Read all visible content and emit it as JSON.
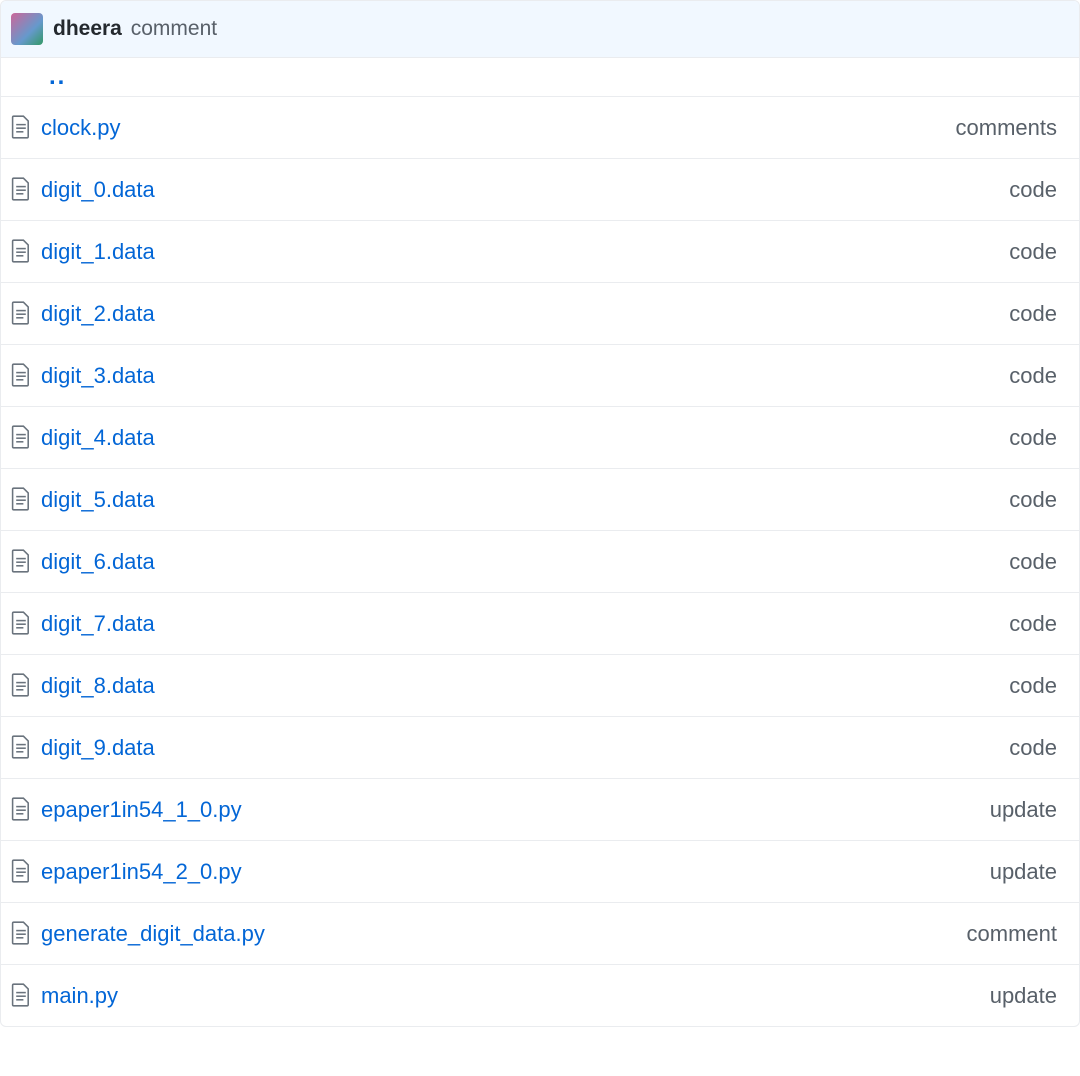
{
  "header": {
    "author": "dheera",
    "commit_message": "comment"
  },
  "parent_dir_label": "..",
  "files": [
    {
      "name": "clock.py",
      "message": "comments"
    },
    {
      "name": "digit_0.data",
      "message": "code"
    },
    {
      "name": "digit_1.data",
      "message": "code"
    },
    {
      "name": "digit_2.data",
      "message": "code"
    },
    {
      "name": "digit_3.data",
      "message": "code"
    },
    {
      "name": "digit_4.data",
      "message": "code"
    },
    {
      "name": "digit_5.data",
      "message": "code"
    },
    {
      "name": "digit_6.data",
      "message": "code"
    },
    {
      "name": "digit_7.data",
      "message": "code"
    },
    {
      "name": "digit_8.data",
      "message": "code"
    },
    {
      "name": "digit_9.data",
      "message": "code"
    },
    {
      "name": "epaper1in54_1_0.py",
      "message": "update"
    },
    {
      "name": "epaper1in54_2_0.py",
      "message": "update"
    },
    {
      "name": "generate_digit_data.py",
      "message": "comment"
    },
    {
      "name": "main.py",
      "message": "update"
    }
  ]
}
